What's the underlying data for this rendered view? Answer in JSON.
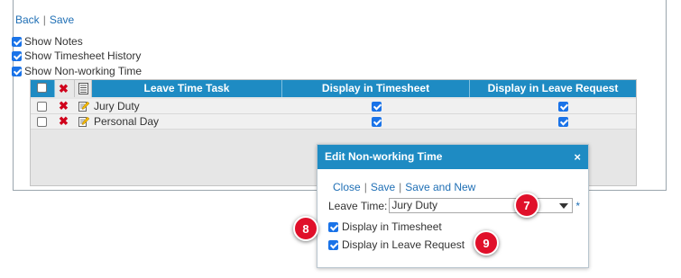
{
  "nav": {
    "back": "Back",
    "separator": "|",
    "save": "Save"
  },
  "options": [
    {
      "label": "Show Notes",
      "checked": true
    },
    {
      "label": "Show Timesheet History",
      "checked": true
    },
    {
      "label": "Show Non-working Time",
      "checked": true
    }
  ],
  "grid": {
    "columns": [
      "Leave Time Task",
      "Display in Timesheet",
      "Display in Leave Request"
    ],
    "rows": [
      {
        "task": "Jury Duty",
        "selected": false,
        "display_in_timesheet": true,
        "display_in_leave_request": true
      },
      {
        "task": "Personal Day",
        "selected": false,
        "display_in_timesheet": true,
        "display_in_leave_request": true
      }
    ]
  },
  "dialog": {
    "title": "Edit Non-working Time",
    "close_icon": "×",
    "links": {
      "close": "Close",
      "save": "Save",
      "save_and_new": "Save and New",
      "separator": "|"
    },
    "leave_time_label": "Leave Time:",
    "leave_time_value": "Jury Duty",
    "required_marker": "*",
    "display_in_timesheet_label": "Display in Timesheet",
    "display_in_timesheet_checked": true,
    "display_in_leave_request_label": "Display in Leave Request",
    "display_in_leave_request_checked": true
  },
  "callouts": [
    "7",
    "8",
    "9"
  ],
  "colors": {
    "header_blue": "#1e8bc3",
    "link_blue": "#1f6fb5",
    "callout_red": "#e0102a",
    "delete_red": "#d0021b",
    "checkbox_blue": "#1a73e8"
  },
  "icons": {
    "delete": "delete-x-icon",
    "edit": "edit-pencil-icon",
    "columns": "column-list-icon"
  }
}
